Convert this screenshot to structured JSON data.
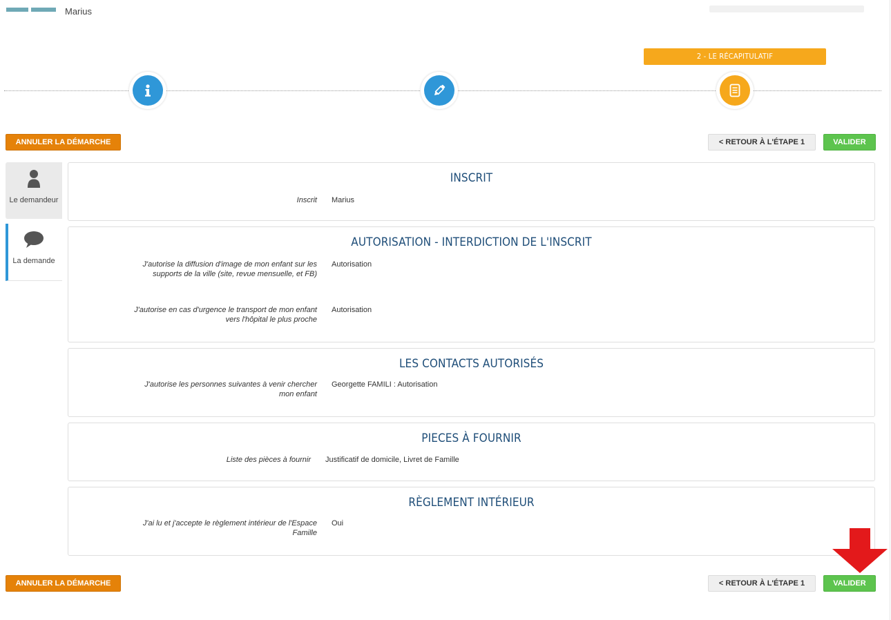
{
  "header": {
    "user_name": "Marius"
  },
  "wizard": {
    "current_step_label": "2 - LE RÉCAPITULATIF",
    "steps": [
      {
        "icon": "info-icon",
        "color": "#2f97d8"
      },
      {
        "icon": "pencil-icon",
        "color": "#2f97d8"
      },
      {
        "icon": "document-icon",
        "color": "#f6a81c"
      }
    ]
  },
  "actions": {
    "cancel_label": "ANNULER LA DÉMARCHE",
    "back_label": "< RETOUR À L'ÉTAPE 1",
    "validate_label": "VALIDER"
  },
  "side_tabs": [
    {
      "label": "Le demandeur",
      "icon": "person-icon"
    },
    {
      "label": "La demande",
      "icon": "speech-bubble-icon"
    }
  ],
  "sections": [
    {
      "title": "INSCRIT",
      "rows": [
        {
          "question": "Inscrit",
          "answer": "Marius"
        }
      ]
    },
    {
      "title": "AUTORISATION - INTERDICTION DE L'INSCRIT",
      "rows": [
        {
          "question": "J'autorise la diffusion d'image de mon enfant sur les supports de la ville (site, revue mensuelle, et FB)",
          "answer": "Autorisation"
        },
        {
          "question": "J'autorise en cas d'urgence le transport de mon enfant vers l'hôpital le plus proche",
          "answer": "Autorisation"
        }
      ]
    },
    {
      "title": "LES CONTACTS AUTORISÉS",
      "rows": [
        {
          "question": "J'autorise les personnes suivantes à venir chercher mon enfant",
          "answer": "Georgette FAMILI : Autorisation"
        }
      ]
    },
    {
      "title": "PIECES À FOURNIR",
      "rows": [
        {
          "question": "Liste des pièces à fournir",
          "answer": "Justificatif de domicile, Livret de Famille"
        }
      ]
    },
    {
      "title": "RÈGLEMENT INTÉRIEUR",
      "rows": [
        {
          "question": "J'ai lu et j'accepte le règlement intérieur de l'Espace Famille",
          "answer": "Oui"
        }
      ]
    }
  ],
  "colors": {
    "accent_orange": "#f6a81c",
    "cancel_orange": "#e58209",
    "validate_green": "#5dc44e",
    "step_blue": "#2f97d8",
    "title_navy": "#1e4d78",
    "annotation_red": "#e3191b"
  }
}
